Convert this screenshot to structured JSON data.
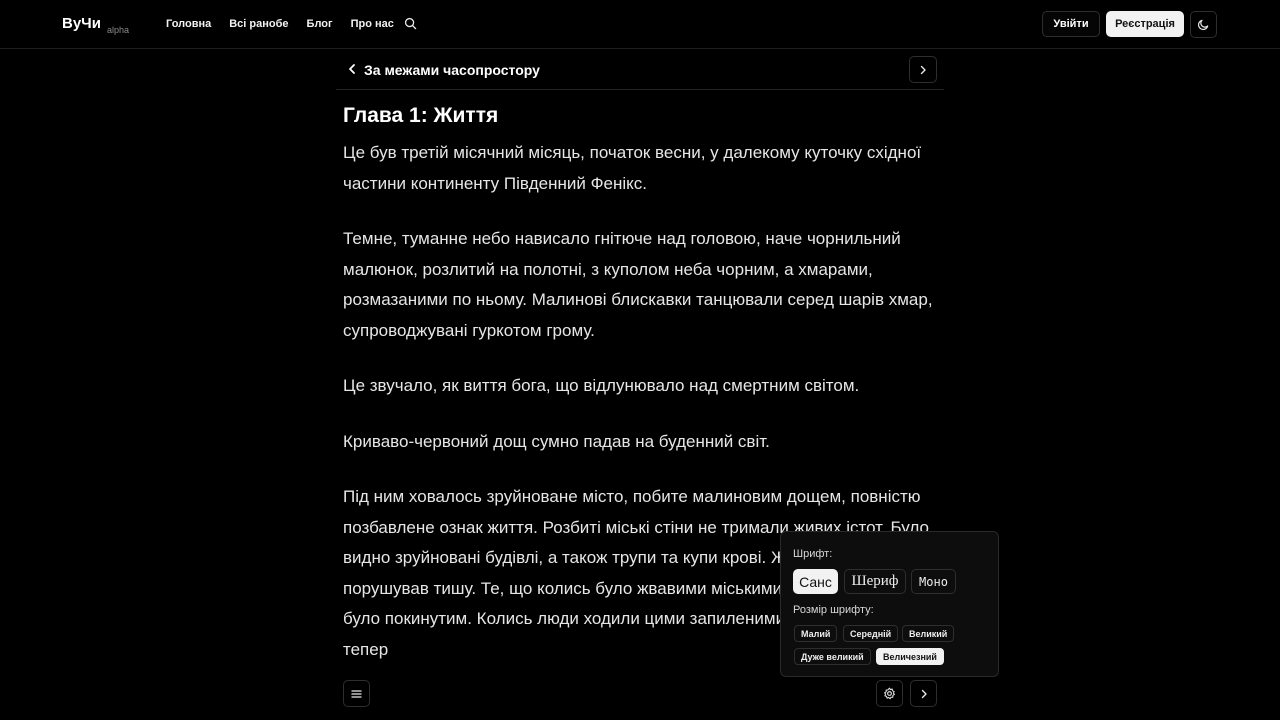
{
  "header": {
    "logo": "ВуЧи",
    "logo_tag": "alpha",
    "nav": [
      "Головна",
      "Всі ранобе",
      "Блог",
      "Про нас"
    ],
    "search_icon": "search-icon",
    "login_label": "Увійти",
    "register_label": "Реєстрація",
    "theme_icon": "moon-icon"
  },
  "chapter_header": {
    "novel_title": "За межами часопростору"
  },
  "chapter": {
    "title": "Глава 1: Життя",
    "paragraphs": [
      "Це був третій місячний місяць, початок весни, у далекому куточку східної частини континенту Південний Фенікс.",
      "Темне, туманне небо нависало гнітюче над головою, наче чорнильний малюнок, розлитий на полотні, з куполом неба чорним, а хмарами, розмазаними по ньому. Малинові блискавки танцювали серед шарів хмар, супроводжувані гуркотом грому.",
      "Це звучало, як виття бога, що відлунювало над смертним світом.",
      "Криваво-червоний дощ сумно падав на буденний світ.",
      "Під ним ховалось зруйноване місто, побите малиновим дощем, повністю позбавлене ознак життя. Розбиті міські стіни не тримали живих істот. Було видно зруйновані будівлі, а також трупи та купи крові. Жоден звук не порушував тишу. Те, що колись було жвавими міськими вулицями, тепер було покинутим. Колись люди ходили цими запиленими шляхами, але тепер"
    ]
  },
  "settings": {
    "font_label": "Шрифт:",
    "fonts": [
      "Санс",
      "Шериф",
      "Моно"
    ],
    "selected_font": "Санс",
    "size_label": "Розмір шрифту:",
    "sizes": [
      "Малий",
      "Середній",
      "Великий",
      "Дуже великий",
      "Величезний"
    ],
    "selected_size": "Величезний"
  },
  "colors": {
    "background": "#000000",
    "text": "#e6e6e6",
    "accent": "#f2f2f2"
  }
}
